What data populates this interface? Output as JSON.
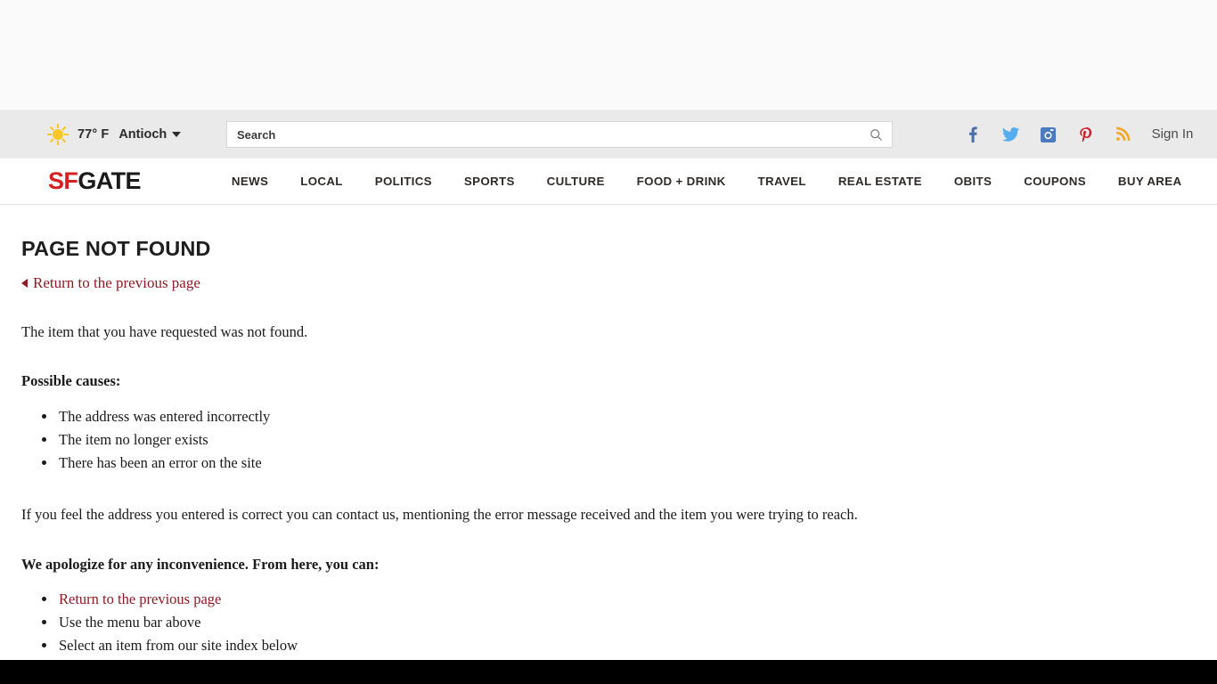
{
  "utility_bar": {
    "weather": {
      "icon": "sun-icon",
      "temperature": "77° F",
      "city": "Antioch",
      "caret": "chevron-down-icon"
    },
    "search": {
      "placeholder": "Search",
      "value": "",
      "icon": "search-icon"
    },
    "social": [
      {
        "name": "facebook-icon",
        "glyph": "f",
        "color": "#4a6ea9"
      },
      {
        "name": "twitter-icon",
        "glyph": "twitter",
        "color": "#55acee"
      },
      {
        "name": "instagram-icon",
        "glyph": "instagram",
        "color": "#4c7bbf"
      },
      {
        "name": "pinterest-icon",
        "glyph": "P",
        "color": "#c8232c"
      },
      {
        "name": "rss-icon",
        "glyph": "rss",
        "color": "#f5a623"
      }
    ],
    "sign_in": "Sign In"
  },
  "brand": {
    "logo_first": "SF",
    "logo_second": "GATE",
    "logo_color_first": "#d62021",
    "logo_color_second": "#1a1a1a"
  },
  "nav": {
    "items": [
      {
        "label": "NEWS"
      },
      {
        "label": "LOCAL"
      },
      {
        "label": "POLITICS"
      },
      {
        "label": "SPORTS"
      },
      {
        "label": "CULTURE"
      },
      {
        "label": "FOOD + DRINK"
      },
      {
        "label": "TRAVEL"
      },
      {
        "label": "REAL ESTATE"
      },
      {
        "label": "OBITS"
      },
      {
        "label": "COUPONS"
      },
      {
        "label": "BUY AREA"
      }
    ]
  },
  "main": {
    "title": "PAGE NOT FOUND",
    "back_link": "Return to the previous page",
    "intro": "The item that you have requested was not found.",
    "causes_heading": "Possible causes:",
    "causes": [
      "The address was entered incorrectly",
      "The item no longer exists",
      "There has been an error on the site"
    ],
    "contact_text": "If you feel the address you entered is correct you can contact us, mentioning the error message received and the item you were trying to reach.",
    "apology_heading": "We apologize for any inconvenience. From here, you can:",
    "options": [
      {
        "label": "Return to the previous page",
        "is_link": true
      },
      {
        "label": "Use the menu bar above",
        "is_link": false
      },
      {
        "label": "Select an item from our site index below",
        "is_link": false
      }
    ]
  },
  "colors": {
    "brand_red": "#d62021",
    "link_red": "#8f1a22",
    "utility_bg": "#eaeaea",
    "ad_bg": "#fafafa",
    "footer_bg": "#000000"
  }
}
